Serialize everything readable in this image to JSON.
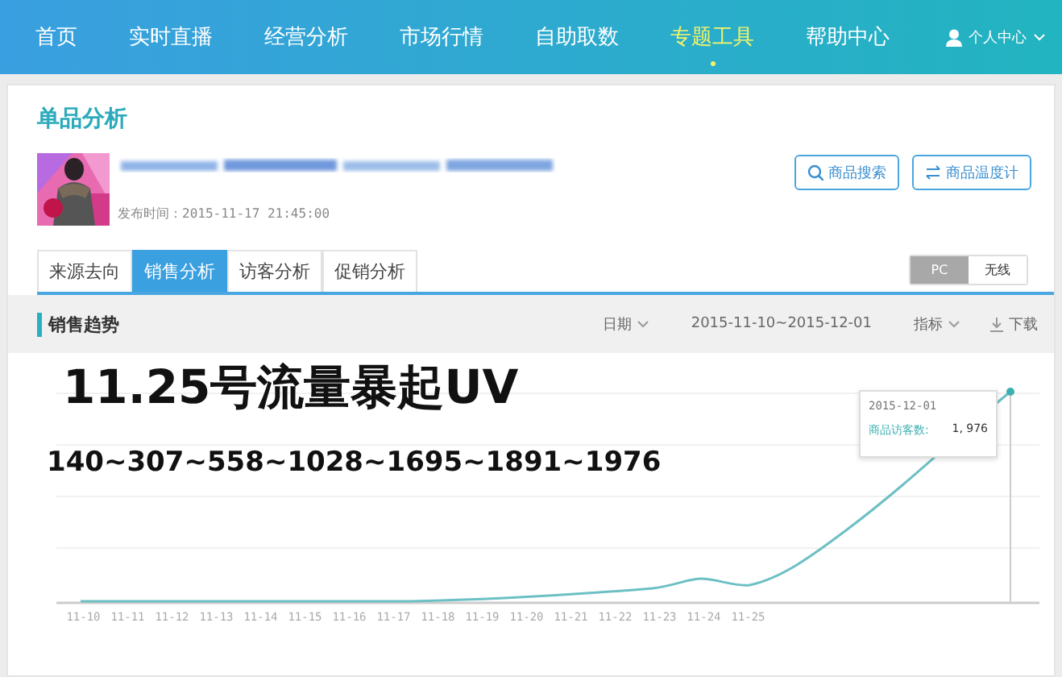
{
  "nav": {
    "items": [
      {
        "label": "首页",
        "selected": false
      },
      {
        "label": "实时直播",
        "selected": false
      },
      {
        "label": "经营分析",
        "selected": false
      },
      {
        "label": "市场行情",
        "selected": false
      },
      {
        "label": "自助取数",
        "selected": false
      },
      {
        "label": "专题工具",
        "selected": true
      },
      {
        "label": "帮助中心",
        "selected": false
      }
    ],
    "user_menu": "个人中心"
  },
  "page_title": "单品分析",
  "product": {
    "publish_time": "发布时间：2015-11-17 21:45:00"
  },
  "buttons": [
    {
      "kind": "search",
      "label": "商品搜索"
    },
    {
      "kind": "swap",
      "label": "商品温度计"
    }
  ],
  "tabs": [
    {
      "label": "来源去向",
      "selected": false
    },
    {
      "label": "销售分析",
      "selected": true
    },
    {
      "label": "访客分析",
      "selected": false
    },
    {
      "label": "促销分析",
      "selected": false
    }
  ],
  "device_toggle": [
    {
      "label": "PC",
      "selected": true
    },
    {
      "label": "无线",
      "selected": false
    }
  ],
  "section": {
    "title": "销售趋势",
    "date_label": "日期",
    "date_range": "2015-11-10~2015-12-01",
    "metric_label": "指标",
    "download": "下载"
  },
  "annotations": [
    "11.25号流量暴起UV",
    "140~307~558~1028~1695~1891~1976"
  ],
  "chart": {
    "x_labels": [
      "11-10",
      "11-11",
      "11-12",
      "11-13",
      "11-14",
      "11-15",
      "11-16",
      "11-17",
      "11-18",
      "11-19",
      "11-20",
      "11-21",
      "11-22",
      "11-23",
      "11-24",
      "11-25"
    ],
    "tooltip": {
      "date": "2015-12-01",
      "label": "商品访客数:",
      "value": "1, 976"
    }
  }
}
